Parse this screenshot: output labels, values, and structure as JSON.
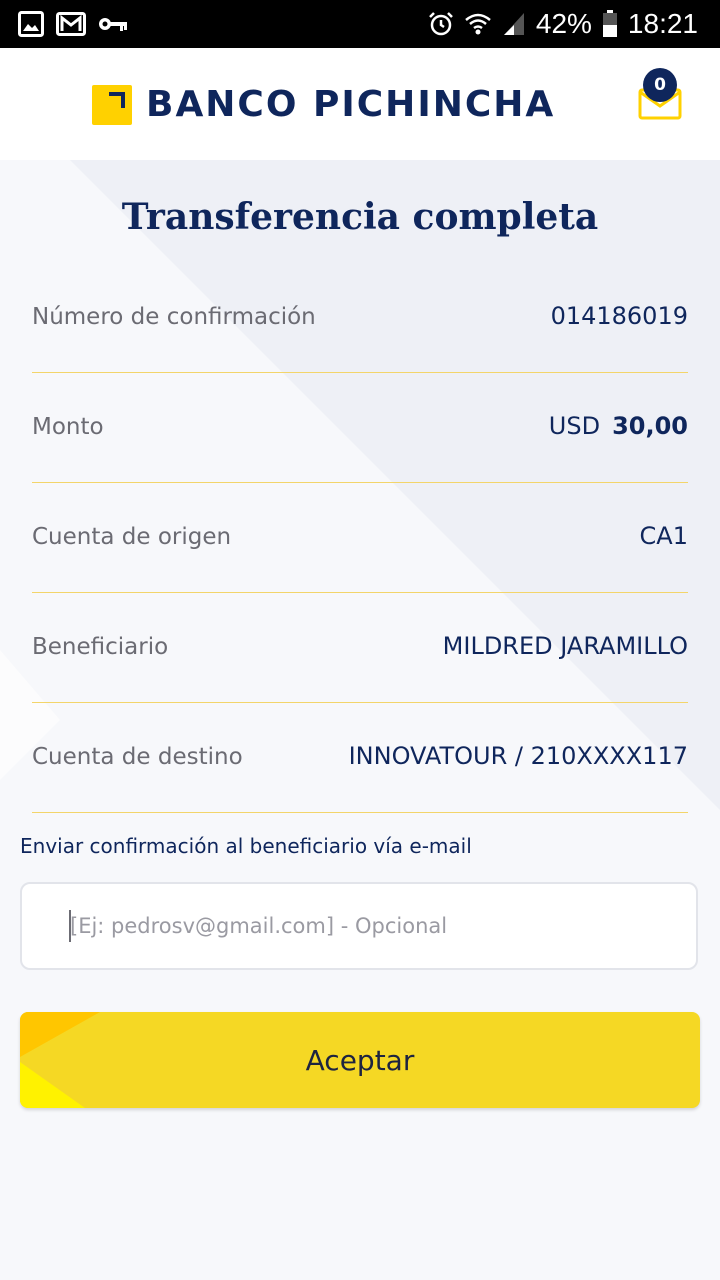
{
  "status_bar": {
    "battery_percent": "42%",
    "time": "18:21",
    "icons": [
      "gallery-icon",
      "gmail-icon",
      "key-icon",
      "alarm-icon",
      "wifi-icon",
      "signal-icon",
      "battery-icon"
    ]
  },
  "header": {
    "brand": "BANCO PICHINCHA",
    "notifications_count": "0"
  },
  "page": {
    "title": "Transferencia completa"
  },
  "details": [
    {
      "label": "Número de confirmación",
      "value": "014186019"
    },
    {
      "label": "Monto",
      "currency": "USD",
      "value": "30,00"
    },
    {
      "label": "Cuenta de origen",
      "value": "CA1"
    },
    {
      "label": "Beneficiario",
      "value": "MILDRED JARAMILLO"
    },
    {
      "label": "Cuenta de destino",
      "value": "INNOVATOUR / 210XXXX117"
    }
  ],
  "email": {
    "label": "Enviar confirmación al beneficiario vía e-mail",
    "placeholder": "[Ej: pedrosv@gmail.com] - Opcional",
    "value": ""
  },
  "actions": {
    "accept_label": "Aceptar"
  },
  "colors": {
    "brand_navy": "#0f265c",
    "brand_yellow": "#ffd100",
    "button_yellow": "#f5d824",
    "divider": "#f3d56a"
  }
}
